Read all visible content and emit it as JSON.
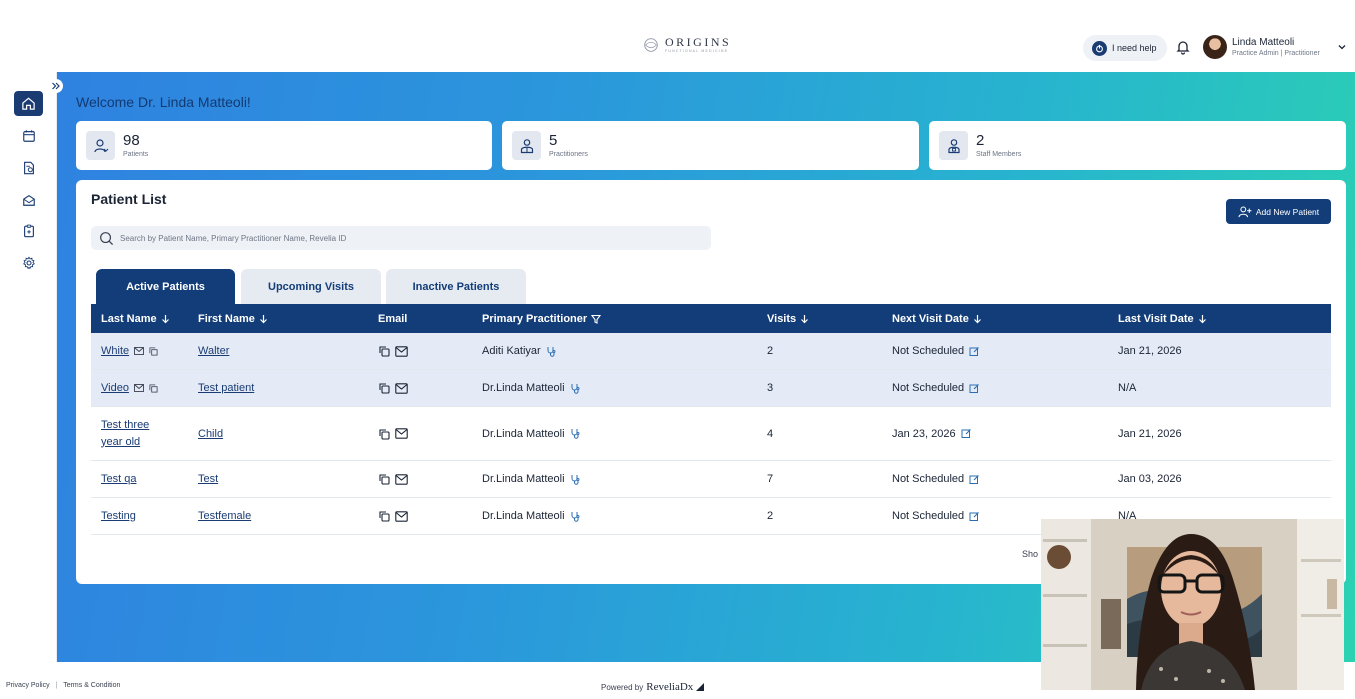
{
  "header": {
    "logo": {
      "name": "ORIGINS",
      "tagline": "FUNCTIONAL MEDICINE"
    },
    "help_label": "I need help",
    "user": {
      "name": "Linda Matteoli",
      "role": "Practice Admin | Practitioner"
    }
  },
  "sidebar": {
    "items": [
      {
        "icon": "home-icon",
        "active": true
      },
      {
        "icon": "calendar-icon",
        "active": false
      },
      {
        "icon": "report-icon",
        "active": false
      },
      {
        "icon": "inbox-icon",
        "active": false
      },
      {
        "icon": "clipboard-icon",
        "active": false
      },
      {
        "icon": "gear-icon",
        "active": false
      }
    ]
  },
  "welcome": "Welcome Dr. Linda Matteoli!",
  "stats": [
    {
      "value": "98",
      "label": "Patients",
      "icon": "patient-icon"
    },
    {
      "value": "5",
      "label": "Practitioners",
      "icon": "practitioner-icon"
    },
    {
      "value": "2",
      "label": "Staff Members",
      "icon": "staff-icon"
    }
  ],
  "patient_list": {
    "title": "Patient List",
    "add_button": "Add New Patient",
    "search_placeholder": "Search by Patient Name, Primary Practitioner Name, Revelia ID",
    "tabs": [
      "Active Patients",
      "Upcoming Visits",
      "Inactive Patients"
    ],
    "columns": [
      "Last Name",
      "First Name",
      "Email",
      "Primary Practitioner",
      "Visits",
      "Next Visit Date",
      "Last Visit Date"
    ],
    "rows": [
      {
        "last": "White",
        "first": "Walter",
        "practitioner": "Aditi Katiyar",
        "visits": "2",
        "next": "Not Scheduled",
        "last_visit": "Jan 21, 2026"
      },
      {
        "last": "Video",
        "first": "Test patient",
        "practitioner": "Dr.Linda Matteoli",
        "visits": "3",
        "next": "Not Scheduled",
        "last_visit": "N/A"
      },
      {
        "last": "Test three year old",
        "first": "Child",
        "practitioner": "Dr.Linda Matteoli",
        "visits": "4",
        "next": "Jan 23, 2026",
        "last_visit": "Jan 21, 2026"
      },
      {
        "last": "Test qa",
        "first": "Test",
        "practitioner": "Dr.Linda Matteoli",
        "visits": "7",
        "next": "Not Scheduled",
        "last_visit": "Jan 03, 2026"
      },
      {
        "last": "Testing",
        "first": "Testfemale",
        "practitioner": "Dr.Linda Matteoli",
        "visits": "2",
        "next": "Not Scheduled",
        "last_visit": "N/A"
      }
    ],
    "show_text": "Sho"
  },
  "footer": {
    "privacy": "Privacy Policy",
    "terms": "Terms & Condition",
    "powered_by": "Powered by",
    "brand": "ReveliaDx"
  },
  "colors": {
    "primary": "#133d78",
    "gradient_start": "#2f82e0",
    "gradient_end": "#2bd2b2"
  }
}
